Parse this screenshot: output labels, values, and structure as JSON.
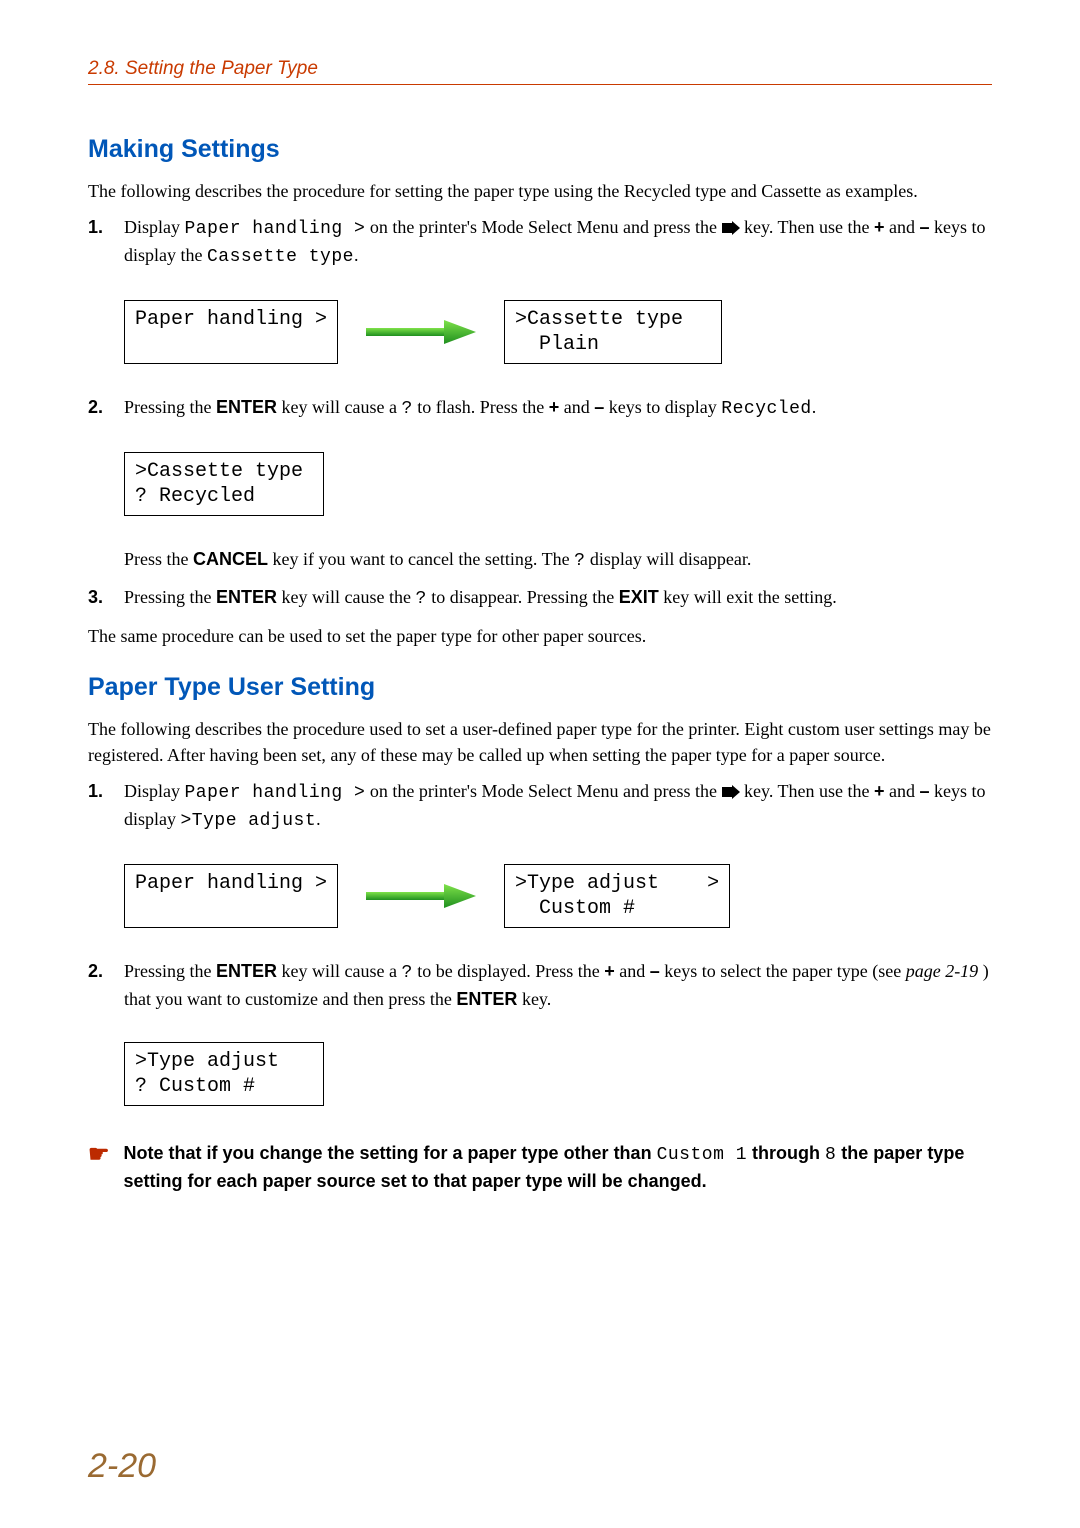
{
  "header": "2.8.  Setting the Paper Type",
  "sectionA": {
    "heading": "Making Settings",
    "intro": "The following describes the procedure for setting the paper type using the Recycled type and Cassette as examples.",
    "step1": {
      "pre": "Display ",
      "lcd1": "Paper handling >",
      "mid1": " on the printer's Mode Select Menu and press the ",
      "keyTail": " key. Then use the ",
      "plus": "+",
      "and": " and ",
      "minus": "–",
      "mid2": " keys to display the ",
      "lcd2": "Cassette type",
      "tail": "."
    },
    "display1": {
      "left": "Paper handling >",
      "rightLine1": ">Cassette type",
      "rightLine2": "  Plain"
    },
    "step2": {
      "pre": "Pressing the ",
      "enter": "ENTER",
      "mid1": " key will cause a ",
      "q": "?",
      "mid2": " to flash. Press the ",
      "plus": "+",
      "and": " and ",
      "minus": "–",
      "mid3": " keys to display ",
      "lcd": "Recycled",
      "tail": "."
    },
    "display2": {
      "line1": ">Cassette type",
      "line2": "? Recycled"
    },
    "step2sub": {
      "pre": "Press the ",
      "cancel": "CANCEL",
      "mid": " key if you want to cancel the setting. The ",
      "q": "?",
      "tail": " display will disappear."
    },
    "step3": {
      "pre": "Pressing the ",
      "enter": "ENTER",
      "mid1": " key will cause the ",
      "q": "?",
      "mid2": " to disappear. Pressing the ",
      "exit": "EXIT",
      "tail": " key will exit the setting."
    },
    "outro": "The same procedure can be used to set the paper type for other paper sources."
  },
  "sectionB": {
    "heading": "Paper Type User Setting",
    "intro": "The following describes the procedure used to set a user-defined paper type for the printer. Eight custom user settings may be registered. After having been set, any of these may be called up when setting the paper type for a paper source.",
    "step1": {
      "pre": "Display ",
      "lcd1": "Paper handling >",
      "mid1": " on the printer's Mode Select Menu and press the ",
      "keyTail": " key. Then use the ",
      "plus": "+",
      "and": " and ",
      "minus": "–",
      "mid2": " keys to display ",
      "lcd2": ">Type adjust",
      "tail": "."
    },
    "display1": {
      "left": "Paper handling >",
      "rightLine1": ">Type adjust    >",
      "rightLine2": "  Custom #"
    },
    "step2": {
      "pre": "Pressing the ",
      "enter": "ENTER",
      "mid1": " key will cause a ",
      "q": "?",
      "mid2": " to be displayed. Press the ",
      "plus": "+",
      "and": " and ",
      "minus": "–",
      "mid3": " keys to select the paper type (see ",
      "pageref": "page 2-19",
      "mid4": " ) that you want to customize and then press the ",
      "enter2": "ENTER",
      "tail": " key."
    },
    "display2": {
      "line1": ">Type adjust",
      "line2": "? Custom #"
    },
    "note": {
      "pre": "Note that if you change the setting for a paper type other than ",
      "lcd1": "Custom 1",
      "mid": " through ",
      "lcd2": "8",
      "tail": " the paper type setting for each paper source set to that paper type will be changed."
    }
  },
  "pageNumber": "2-20"
}
